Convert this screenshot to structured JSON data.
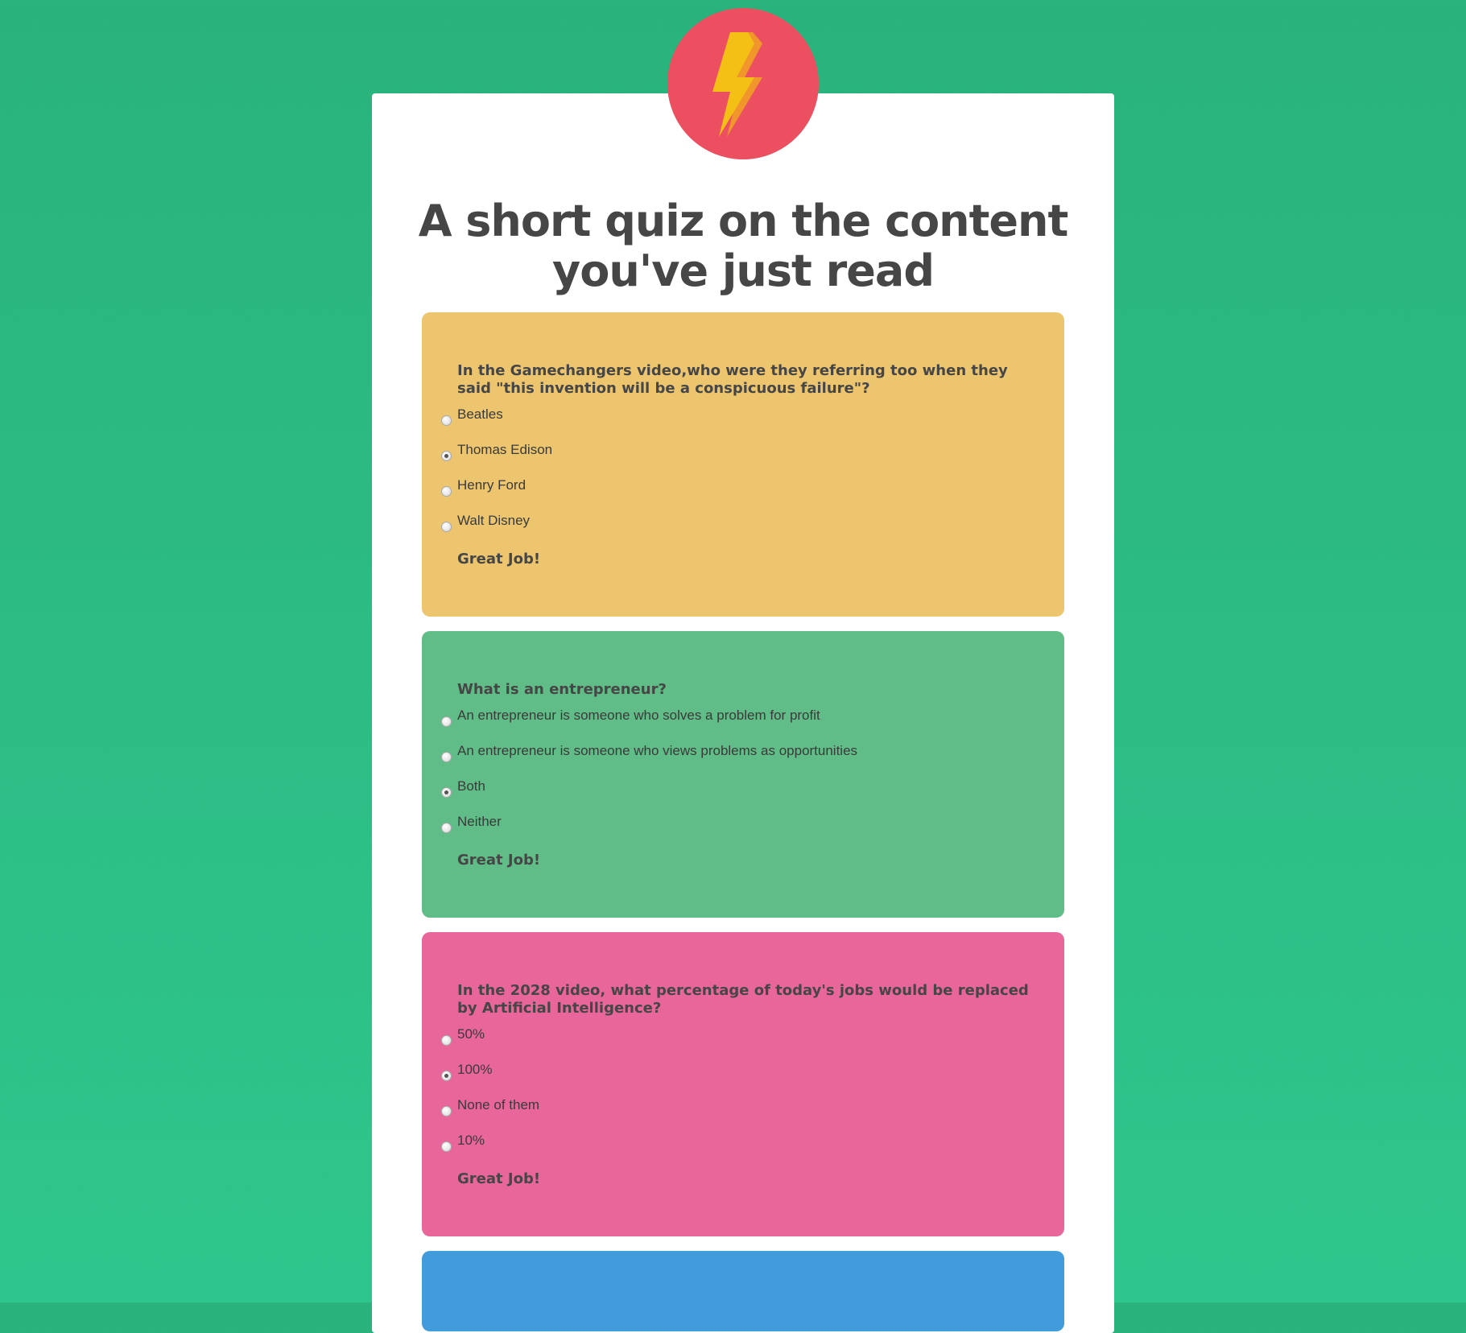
{
  "page": {
    "title": "A short quiz on the content you've just read",
    "logo_icon": "lightning-bolt-icon",
    "colors": {
      "background": "#2ab27c",
      "logo": "#ec4f5f",
      "bolt": "#f5c016",
      "q1": "#ecc56e",
      "q2": "#61bd87",
      "q3": "#e8669a",
      "q4": "#429cdc"
    }
  },
  "questions": [
    {
      "text": "In the Gamechangers video,who were they referring too when they said \"this invention will be a conspicuous failure\"?",
      "options": [
        "Beatles",
        "Thomas Edison",
        "Henry Ford",
        "Walt Disney"
      ],
      "selected": "Thomas Edison",
      "feedback": "Great Job!"
    },
    {
      "text": "What is an entrepreneur?",
      "options": [
        "An entrepreneur is someone who solves a problem for profit",
        "An entrepreneur is someone who views problems as opportunities",
        "Both",
        "Neither"
      ],
      "selected": "Both",
      "feedback": "Great Job!"
    },
    {
      "text": "In the 2028 video, what percentage of today's jobs would be replaced by Artificial Intelligence?",
      "options": [
        "50%",
        "100%",
        "None of them",
        "10%"
      ],
      "selected": "100%",
      "feedback": "Great Job!"
    }
  ]
}
